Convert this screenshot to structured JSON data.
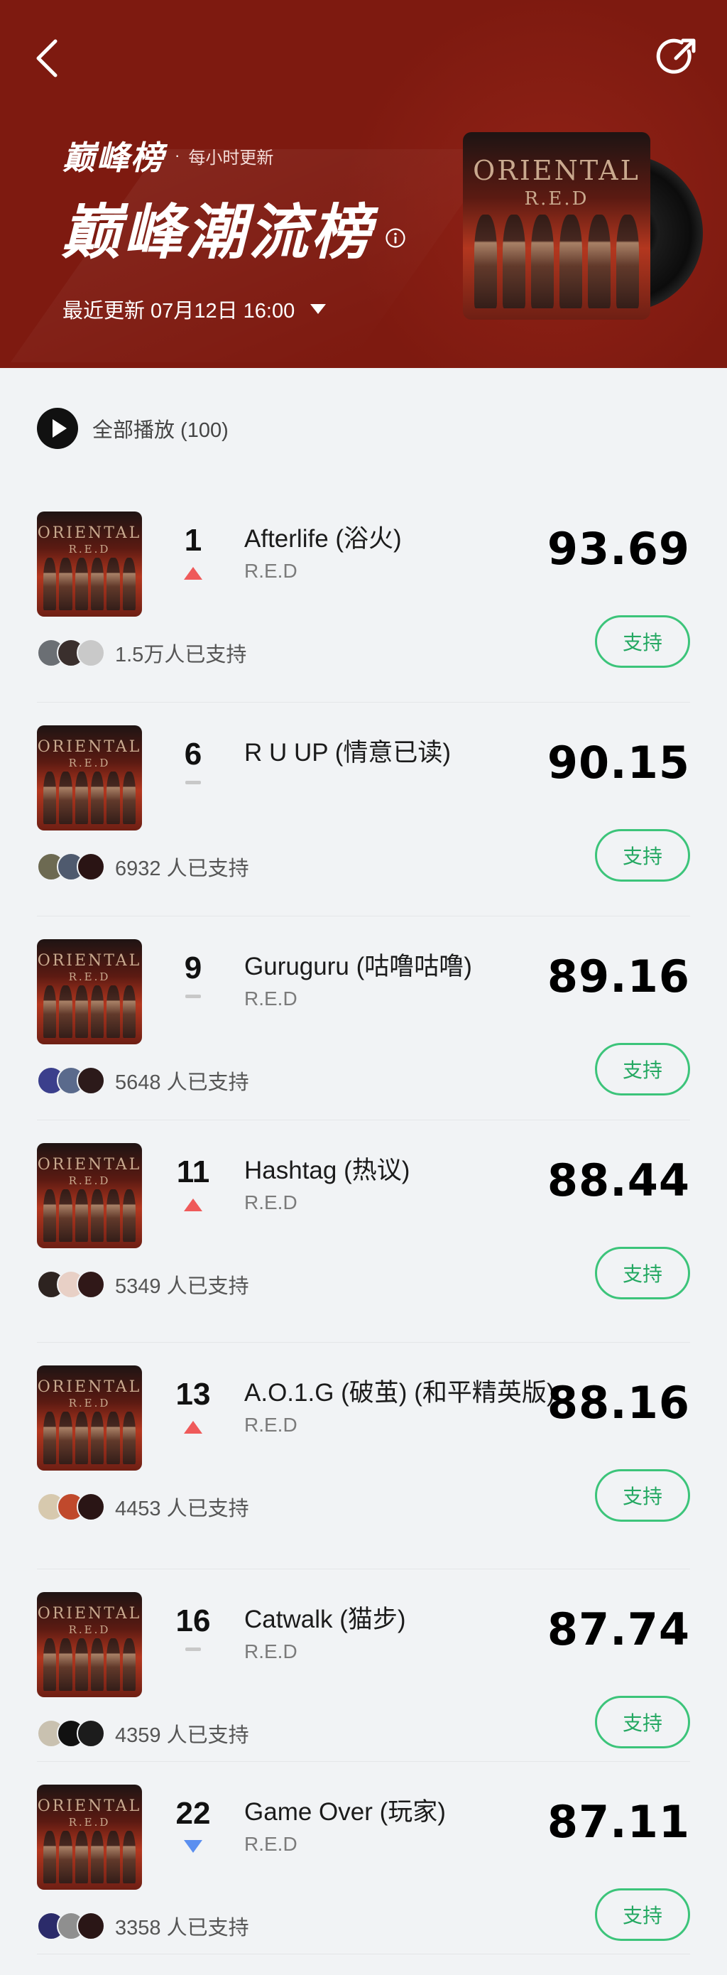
{
  "header": {
    "brand_logo": "巅峰榜",
    "brand_dot": "·",
    "hourly_update": "每小时更新",
    "title": "巅峰潮流榜",
    "update_label": "最近更新 07月12日 16:00",
    "colors": {
      "background": "#7e1a10",
      "text": "#ffffff"
    },
    "cover": {
      "title_line1": "ORIENTAL",
      "title_line2": "R.E.D"
    }
  },
  "play_all": {
    "label": "全部播放 (100)"
  },
  "songs": [
    {
      "rank": "1",
      "trend": "up",
      "title": "Afterlife (浴火)",
      "artist": "R.E.D",
      "score": "93.69",
      "supporters": "1.5万人已支持",
      "button": "支持"
    },
    {
      "rank": "6",
      "trend": "flat",
      "title": "R U UP (情意已读)",
      "artist": "",
      "score": "90.15",
      "supporters": "6932 人已支持",
      "button": "支持"
    },
    {
      "rank": "9",
      "trend": "flat",
      "title": "Guruguru (咕噜咕噜)",
      "artist": "R.E.D",
      "score": "89.16",
      "supporters": "5648 人已支持",
      "button": "支持"
    },
    {
      "rank": "11",
      "trend": "up",
      "title": "Hashtag (热议)",
      "artist": "R.E.D",
      "score": "88.44",
      "supporters": "5349 人已支持",
      "button": "支持"
    },
    {
      "rank": "13",
      "trend": "up",
      "title": "A.O.1.G (破茧) (和平精英版)",
      "artist": "R.E.D",
      "score": "88.16",
      "supporters": "4453 人已支持",
      "button": "支持"
    },
    {
      "rank": "16",
      "trend": "flat",
      "title": "Catwalk (猫步)",
      "artist": "R.E.D",
      "score": "87.74",
      "supporters": "4359 人已支持",
      "button": "支持"
    },
    {
      "rank": "22",
      "trend": "down",
      "title": "Game Over (玩家)",
      "artist": "R.E.D",
      "score": "87.11",
      "supporters": "3358 人已支持",
      "button": "支持"
    }
  ],
  "colors": {
    "up": "#ef5a5a",
    "down": "#5b8ff0",
    "flat": "#c8c8c8",
    "support_green": "#3cc47a"
  },
  "icons": {
    "back": "chevron-left-icon",
    "share": "share-icon",
    "info": "info-icon",
    "dropdown": "triangle-down-icon",
    "play": "play-icon"
  }
}
